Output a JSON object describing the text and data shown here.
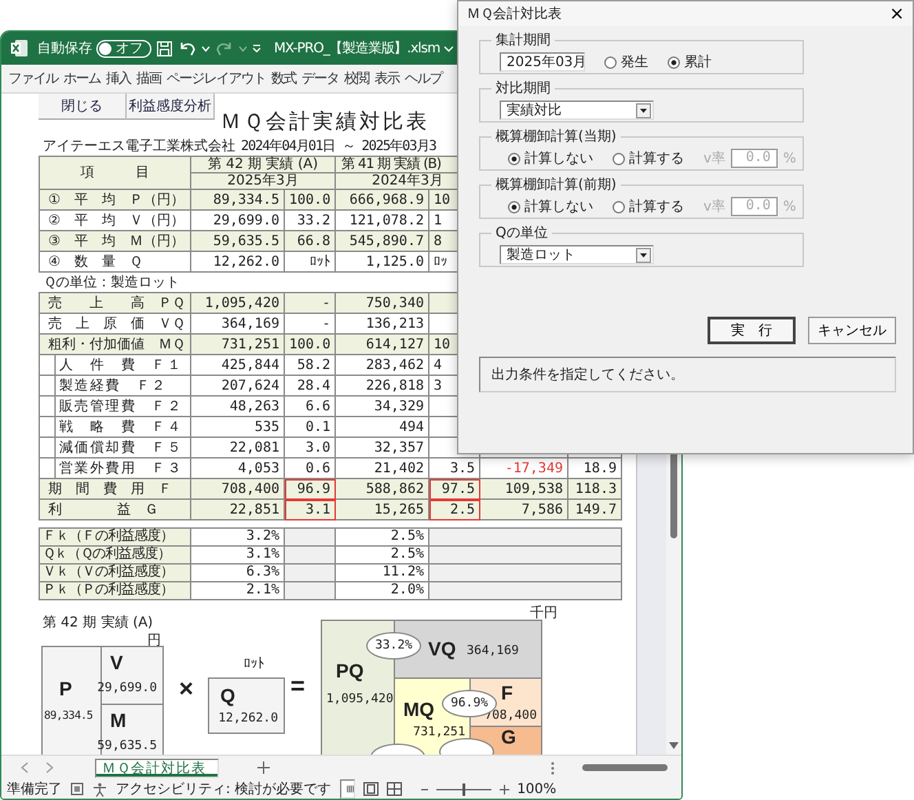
{
  "excel": {
    "autosave": {
      "label": "自動保存",
      "toggle": "オフ",
      "on": false
    },
    "filename": "MX-PRO_【製造業版】.xlsm",
    "menu": [
      "ファイル",
      "ホーム",
      "挿入",
      "描画",
      "ページレイアウト",
      "数式",
      "データ",
      "校閲",
      "表示",
      "ヘルプ"
    ],
    "sheet": {
      "buttons": [
        "閉じる",
        "利益感度分析"
      ],
      "title": "ＭＱ会計実績対比表",
      "company": "アイテーエス電子工業株式会社",
      "period": "2024年04月01日 ～ 2025年03月3",
      "header": {
        "item": "項　　　目",
        "period_a": "第 42 期 実績 (A)",
        "month_a": "2025年3月",
        "period_b": "第 41 期 実績 (B)",
        "month_b": "2024年3月"
      },
      "rows": [
        {
          "kind": "main",
          "shaded": true,
          "label": "①　平　均　Ｐ（円）",
          "cells": [
            "89,334.5",
            "100.0",
            "666,968.9",
            "10"
          ]
        },
        {
          "kind": "main",
          "shaded": false,
          "label": "②　平　均　Ｖ（円）",
          "cells": [
            "29,699.0",
            "33.2",
            "121,078.2",
            "1"
          ]
        },
        {
          "kind": "main",
          "shaded": true,
          "label": "③　平　均　Ｍ（円）",
          "cells": [
            "59,635.5",
            "66.8",
            "545,890.7",
            "8"
          ]
        },
        {
          "kind": "main",
          "shaded": false,
          "label": "④　数　量　Ｑ",
          "cells": [
            "12,262.0",
            "ﾛｯﾄ",
            "1,125.0",
            "ﾛｯ"
          ]
        },
        {
          "kind": "note",
          "label": "Ｑの単位：製造ロット"
        },
        {
          "kind": "main",
          "shaded": true,
          "label": "売　　上　　高　ＰＱ",
          "cells": [
            "1,095,420",
            "-",
            "750,340"
          ]
        },
        {
          "kind": "main",
          "shaded": false,
          "label": "売　上　原　価　ＶＱ",
          "cells": [
            "364,169",
            "-",
            "136,213"
          ]
        },
        {
          "kind": "main",
          "shaded": true,
          "label": "粗利・付加価値　ＭＱ",
          "cells": [
            "731,251",
            "100.0",
            "614,127",
            "10"
          ]
        },
        {
          "kind": "sub",
          "shaded": false,
          "label": "人　件　費　Ｆ１",
          "cells": [
            "425,844",
            "58.2",
            "283,462",
            "4"
          ]
        },
        {
          "kind": "sub",
          "shaded": false,
          "label": "製造経費　Ｆ２",
          "cells": [
            "207,624",
            "28.4",
            "226,818",
            "3"
          ]
        },
        {
          "kind": "sub",
          "shaded": false,
          "label": "販売管理費　Ｆ２",
          "cells": [
            "48,263",
            "6.6",
            "34,329"
          ]
        },
        {
          "kind": "sub",
          "shaded": false,
          "label": "戦　略　費　Ｆ４",
          "cells": [
            "535",
            "0.1",
            "494"
          ]
        },
        {
          "kind": "sub",
          "shaded": false,
          "label": "減価償却費　Ｆ５",
          "cells": [
            "22,081",
            "3.0",
            "32,357"
          ]
        },
        {
          "kind": "sub",
          "shaded": false,
          "label": "営業外費用　Ｆ３",
          "cells": [
            "4,053",
            "0.6",
            "21,402",
            "3.5",
            {
              "text": "-17,349",
              "negative": true
            },
            "18.9"
          ]
        },
        {
          "kind": "main",
          "shaded": true,
          "label": "期　間　費　用　Ｆ",
          "cells": [
            "708,400",
            {
              "text": "96.9",
              "boxed": true
            },
            "588,862",
            {
              "text": "97.5",
              "boxed": true
            },
            "109,538",
            "118.3"
          ]
        },
        {
          "kind": "main",
          "shaded": true,
          "label": "利　　　　益　Ｇ",
          "cells": [
            "22,851",
            {
              "text": "3.1",
              "boxed": true
            },
            "15,265",
            {
              "text": "2.5",
              "boxed": true
            },
            "7,586",
            "149.7"
          ]
        }
      ],
      "sensitivity": [
        {
          "label": "Ｆｋ（Ｆの利益感度）",
          "a": "3.2%",
          "b": "2.5%"
        },
        {
          "label": "Ｑｋ（Ｑの利益感度）",
          "a": "3.1%",
          "b": "2.5%"
        },
        {
          "label": "Ｖｋ（Ｖの利益感度）",
          "a": "6.3%",
          "b": "11.2%"
        },
        {
          "label": "Ｐｋ（Ｐの利益感度）",
          "a": "2.1%",
          "b": "2.0%"
        }
      ],
      "diagram": {
        "title": "第 42 期 実績 (A)",
        "unit_price": "円",
        "p": {
          "label": "P",
          "value": "89,334.5"
        },
        "v": {
          "label": "V",
          "value": "29,699.0"
        },
        "m": {
          "label": "M",
          "value": "59,635.5"
        },
        "times": "×",
        "unit_q": "ﾛｯﾄ",
        "q": {
          "label": "Q",
          "value": "12,262.0"
        },
        "equals": "=",
        "unit_total": "千円",
        "pq": {
          "label": "PQ",
          "value": "1,095,420"
        },
        "vq": {
          "label": "VQ",
          "value": "364,169",
          "ratio": "33.2%"
        },
        "mq": {
          "label": "MQ",
          "value": "731,251"
        },
        "f": {
          "label": "F",
          "value": "708,400",
          "ratio": "96.9%"
        },
        "g": {
          "label": "G"
        }
      }
    },
    "sheet_tabs": [
      {
        "label": "ＭＱ会計対比表",
        "selected": true
      }
    ],
    "status": {
      "ready": "準備完了",
      "accessibility": "アクセシビリティ: 検討が必要です",
      "zoom_slider": {
        "level": 0.5
      },
      "zoom": "100%"
    }
  },
  "dialog": {
    "title": "ＭＱ会計対比表",
    "close": "×",
    "groups": [
      {
        "kind": "period",
        "legend": "集計期間",
        "select": "2025年03月",
        "options": [
          {
            "label": "発生",
            "selected": false
          },
          {
            "label": "累計",
            "selected": true
          }
        ]
      },
      {
        "kind": "select",
        "legend": "対比期間",
        "select": "実績対比"
      },
      {
        "kind": "inventory",
        "legend": "概算棚卸計算(当期)",
        "options": [
          {
            "label": "計算しない",
            "selected": true
          },
          {
            "label": "計算する",
            "selected": false
          }
        ],
        "rate": {
          "label": "v率",
          "value": "0.0",
          "unit": "%",
          "disabled": true
        }
      },
      {
        "kind": "inventory",
        "legend": "概算棚卸計算(前期)",
        "options": [
          {
            "label": "計算しない",
            "selected": true
          },
          {
            "label": "計算する",
            "selected": false
          }
        ],
        "rate": {
          "label": "v率",
          "value": "0.0",
          "unit": "%",
          "disabled": true
        }
      },
      {
        "kind": "select",
        "legend": "Qの単位",
        "select": "製造ロット"
      }
    ],
    "buttons": [
      {
        "label": "実　行",
        "default": true
      },
      {
        "label": "キャンセル",
        "default": false
      }
    ],
    "message": "出力条件を指定してください。"
  }
}
